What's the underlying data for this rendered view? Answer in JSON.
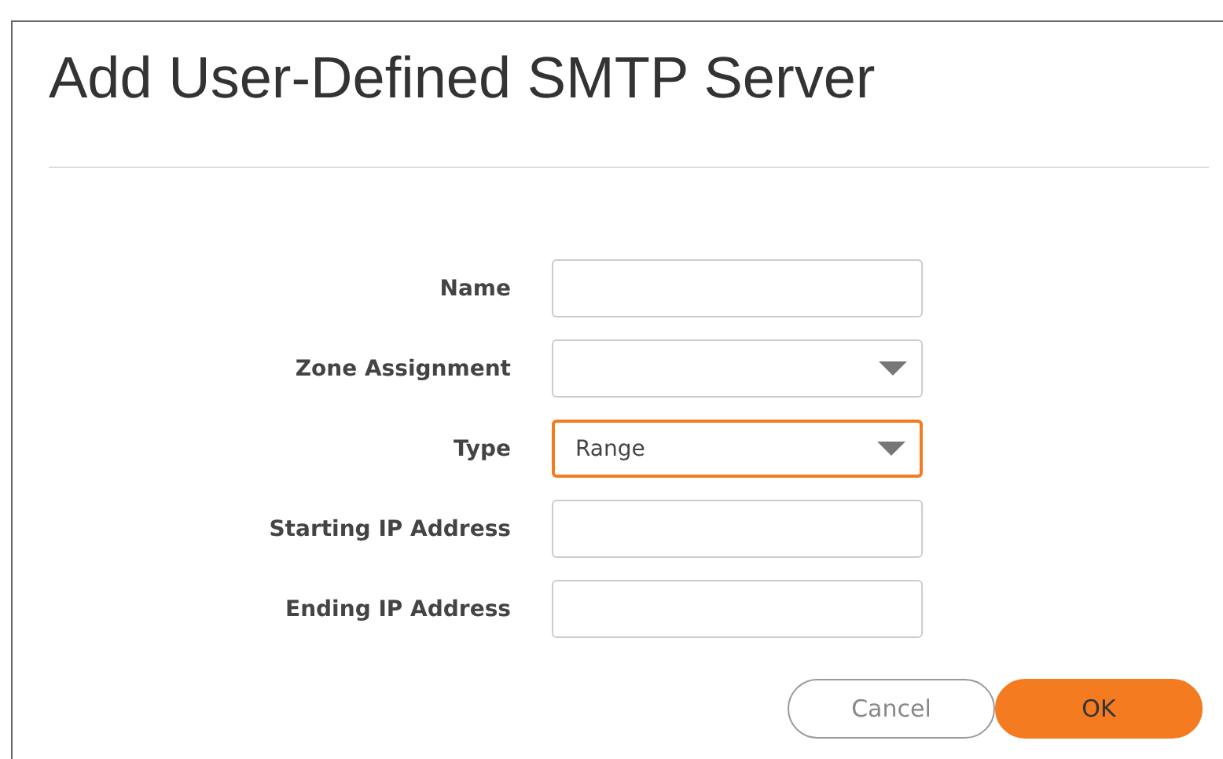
{
  "dialog": {
    "title": "Add User-Defined SMTP Server"
  },
  "fields": [
    {
      "label": "Name",
      "kind": "text",
      "focused": false
    },
    {
      "label": "Zone Assignment",
      "kind": "select",
      "focused": false
    },
    {
      "label": "Type",
      "kind": "select",
      "value": "Range",
      "focused": true
    },
    {
      "label": "Starting IP Address",
      "kind": "text",
      "focused": false
    },
    {
      "label": "Ending IP Address",
      "kind": "text",
      "focused": false
    }
  ],
  "buttons": [
    {
      "label": "Cancel",
      "kind": "secondary"
    },
    {
      "label": "OK",
      "kind": "primary"
    }
  ]
}
